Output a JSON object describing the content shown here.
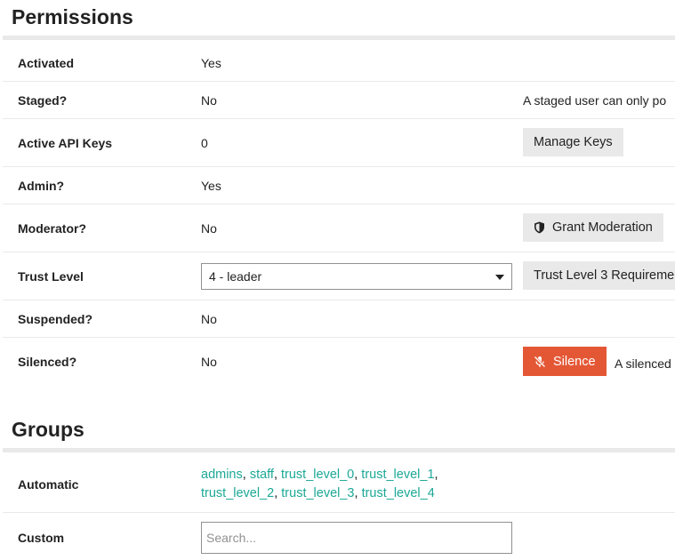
{
  "permissions": {
    "title": "Permissions",
    "activated": {
      "label": "Activated",
      "value": "Yes"
    },
    "staged": {
      "label": "Staged?",
      "value": "No",
      "description": "A staged user can only po"
    },
    "api_keys": {
      "label": "Active API Keys",
      "value": "0",
      "button": "Manage Keys"
    },
    "admin": {
      "label": "Admin?",
      "value": "Yes"
    },
    "moderator": {
      "label": "Moderator?",
      "value": "No",
      "button": "Grant Moderation",
      "button_icon": "shield-icon"
    },
    "trust_level": {
      "label": "Trust Level",
      "selected": "4 - leader",
      "button": "Trust Level 3 Requireme"
    },
    "suspended": {
      "label": "Suspended?",
      "value": "No"
    },
    "silenced": {
      "label": "Silenced?",
      "value": "No",
      "button": "Silence",
      "button_icon": "microphone-slash-icon",
      "description": "A silenced"
    }
  },
  "groups": {
    "title": "Groups",
    "automatic": {
      "label": "Automatic",
      "items": [
        "admins",
        "staff",
        "trust_level_0",
        "trust_level_1",
        "trust_level_2",
        "trust_level_3",
        "trust_level_4"
      ]
    },
    "custom": {
      "label": "Custom",
      "placeholder": "Search..."
    }
  },
  "colors": {
    "link": "#1ba896",
    "danger_button": "#e45735",
    "button_bg": "#e9e9e9",
    "divider": "#e9e9e9"
  }
}
